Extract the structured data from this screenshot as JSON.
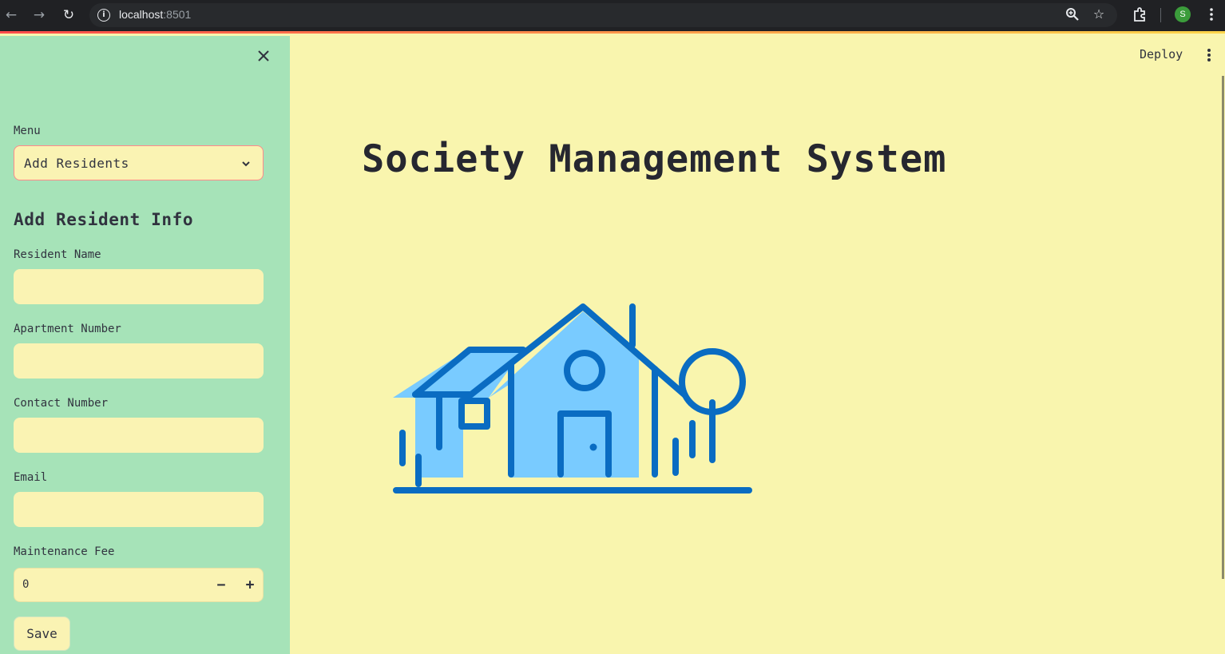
{
  "browser": {
    "url_host": "localhost",
    "url_port": ":8501",
    "profile_initial": "S"
  },
  "sidebar": {
    "menu_label": "Menu",
    "menu_selected": "Add Residents",
    "section_title": "Add Resident Info",
    "fields": {
      "resident_name_label": "Resident Name",
      "resident_name_value": "",
      "apartment_number_label": "Apartment Number",
      "apartment_number_value": "",
      "contact_number_label": "Contact Number",
      "contact_number_value": "",
      "email_label": "Email",
      "email_value": "",
      "maintenance_fee_label": "Maintenance Fee",
      "maintenance_fee_value": "0"
    },
    "save_label": "Save"
  },
  "header": {
    "deploy_label": "Deploy"
  },
  "main": {
    "title": "Society Management System"
  },
  "colors": {
    "sidebar_bg": "#a6e3b8",
    "main_bg": "#f9f5ae",
    "input_bg": "#faf3b3",
    "house_dark": "#0a6cc2",
    "house_light": "#79cbff",
    "accent": "#ff4b4b"
  }
}
